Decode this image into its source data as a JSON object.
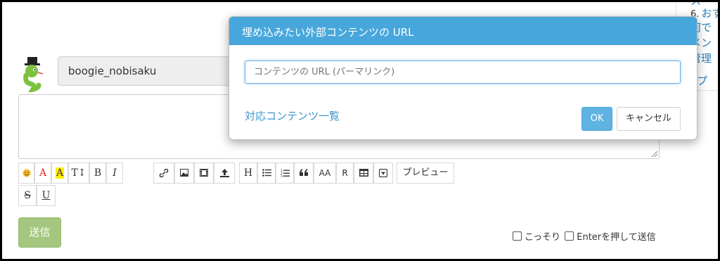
{
  "sidebar": {
    "items": [
      {
        "num": "6.",
        "label": "おす"
      },
      {
        "num": "",
        "label": "何で"
      },
      {
        "num": "",
        "label": "メン"
      },
      {
        "num": "",
        "label": "管理"
      },
      {
        "num": "",
        "label": "ップ"
      }
    ]
  },
  "comment_form": {
    "username": "boogie_nobisaku",
    "textarea_value": ""
  },
  "toolbar": {
    "buttons": [
      {
        "name": "emoji-icon"
      },
      {
        "name": "font-color-icon",
        "label": "A"
      },
      {
        "name": "highlight-icon",
        "label": "A"
      },
      {
        "name": "font-size-icon",
        "label": "T↕"
      },
      {
        "name": "bold-icon",
        "label": "B"
      },
      {
        "name": "italic-icon",
        "label": "I"
      },
      {
        "name": "link-icon"
      },
      {
        "name": "image-icon"
      },
      {
        "name": "movie-icon"
      },
      {
        "name": "upload-icon"
      },
      {
        "name": "heading-icon",
        "label": "H"
      },
      {
        "name": "bulleted-list-icon"
      },
      {
        "name": "numbered-list-icon"
      },
      {
        "name": "quote-icon",
        "label": "66"
      },
      {
        "name": "aa-icon",
        "label": "AA"
      },
      {
        "name": "ruby-icon",
        "label": "R"
      },
      {
        "name": "table-icon"
      },
      {
        "name": "embed-icon"
      },
      {
        "name": "strikethrough-icon",
        "label": "S"
      },
      {
        "name": "underline-icon",
        "label": "U"
      }
    ],
    "preview_label": "プレビュー"
  },
  "send_label": "送信",
  "options": {
    "secret_label": "こっそり",
    "enter_send_label": "Enterを押して送信"
  },
  "modal": {
    "title": "埋め込みたい外部コンテンツの URL",
    "input_placeholder": "コンテンツの URL (パーマリンク)",
    "input_value": "",
    "content_list_link": "対応コンテンツ一覧",
    "ok_label": "OK",
    "cancel_label": "キャンセル"
  },
  "colors": {
    "modal_header": "#47a7dc",
    "send_button": "#a5c67e",
    "ok_button": "#5fb3e3",
    "link": "#3a95cd"
  }
}
